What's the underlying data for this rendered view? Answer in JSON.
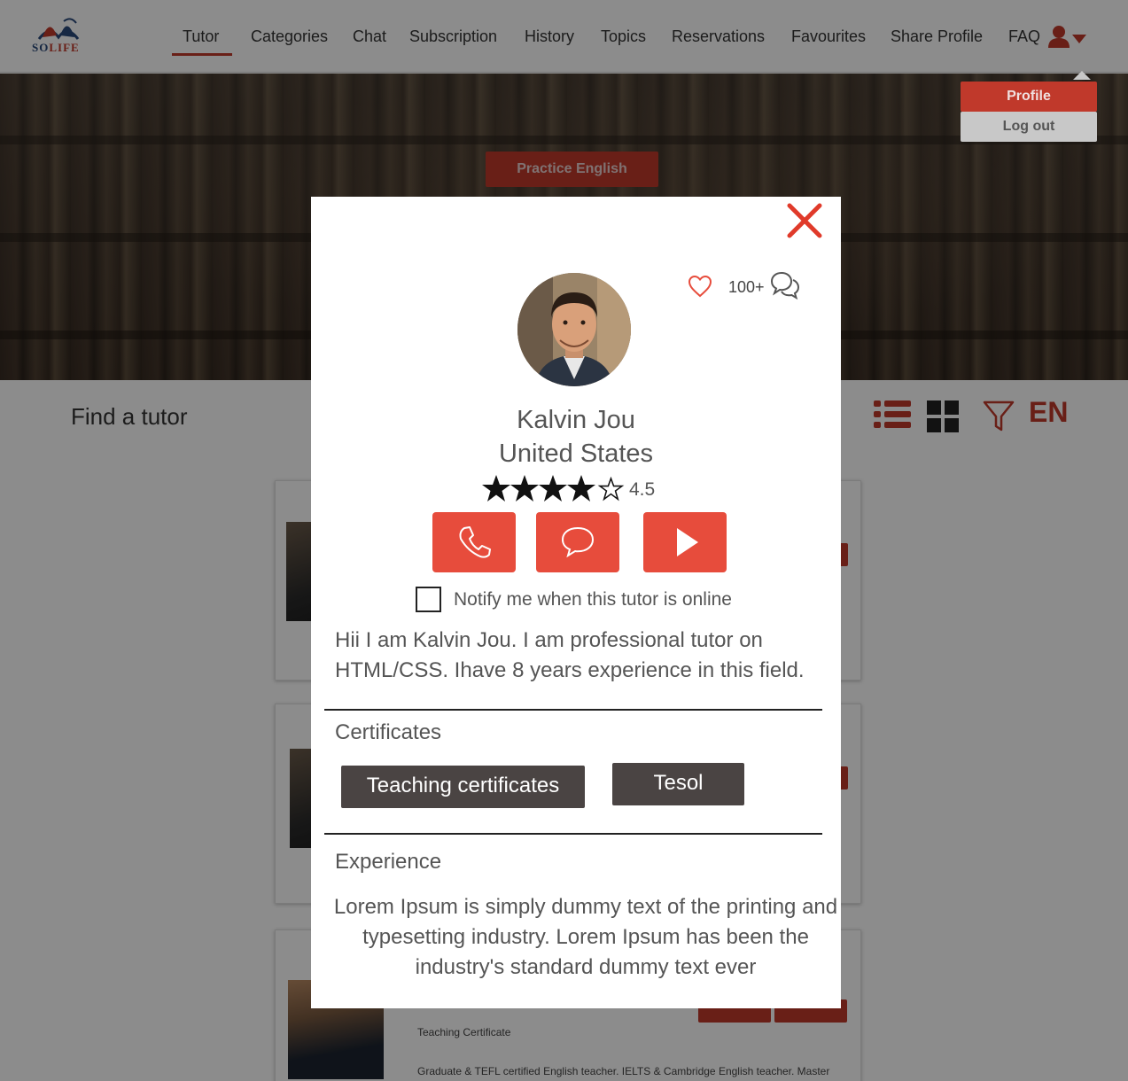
{
  "nav": {
    "logo_text": "SOLIFE",
    "items": [
      {
        "label": "Tutor",
        "active": true
      },
      {
        "label": "Categories"
      },
      {
        "label": "Chat"
      },
      {
        "label": "Subscription"
      },
      {
        "label": "History"
      },
      {
        "label": "Topics"
      },
      {
        "label": "Reservations"
      },
      {
        "label": "Favourites"
      },
      {
        "label": "Share Profile"
      },
      {
        "label": "FAQ"
      }
    ],
    "user_icon": "user-icon",
    "accent": "#c0392b"
  },
  "dropdown": {
    "profile_label": "Profile",
    "logout_label": "Log out"
  },
  "hero": {
    "button_label": "Practice English"
  },
  "page": {
    "title": "Find a tutor",
    "language": "EN"
  },
  "cards": [
    {
      "certificate": "",
      "description": ""
    },
    {
      "certificate": "",
      "description": ""
    },
    {
      "certificate": "Teaching Certificate",
      "description": "Graduate & TEFL certified English teacher. IELTS &  Cambridge English teacher. Master"
    }
  ],
  "modal": {
    "review_count": "100+",
    "tutor_name": "Kalvin Jou",
    "tutor_country": "United States",
    "rating": "4.5",
    "rating_value": 4.5,
    "notify_label": "Notify me when this tutor is online",
    "notify_checked": false,
    "bio": "Hii I am Kalvin Jou. I am professional tutor on HTML/CSS. Ihave 8 years experience in this field.",
    "certificates_title": "Certificates",
    "certificates": [
      "Teaching certificates",
      "Tesol"
    ],
    "experience_title": "Experience",
    "experience_text": "Lorem Ipsum is simply dummy text of the printing and typesetting industry. Lorem Ipsum has been the industry's standard dummy text ever",
    "actions": [
      "phone-icon",
      "chat-icon",
      "play-icon"
    ]
  }
}
